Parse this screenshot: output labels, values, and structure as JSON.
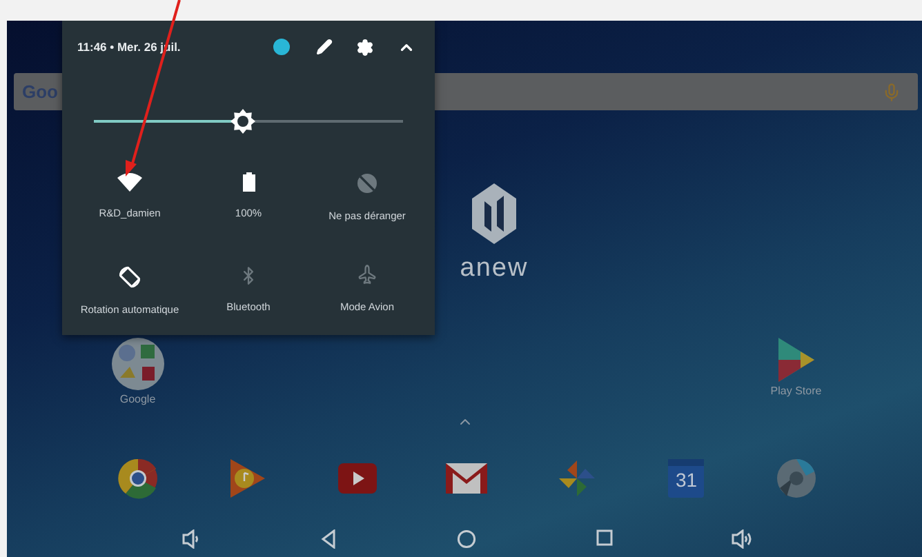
{
  "quick_settings": {
    "time_date": "11:46 • Mer. 26 juil.",
    "brightness": {
      "level": 0.48
    },
    "tiles": [
      {
        "kind": "wifi",
        "label": "R&D_damien",
        "on": true
      },
      {
        "kind": "battery",
        "label": "100%",
        "on": true
      },
      {
        "kind": "dnd",
        "label": "Ne pas déranger",
        "on": false
      },
      {
        "kind": "rotation",
        "label": "Rotation automatique",
        "on": true
      },
      {
        "kind": "bluetooth",
        "label": "Bluetooth",
        "on": false
      },
      {
        "kind": "airplane",
        "label": "Mode Avion",
        "on": false
      }
    ]
  },
  "search_bar": {
    "text": "Goo"
  },
  "logo": {
    "text": "anew"
  },
  "home_apps": [
    {
      "kind": "folder",
      "label": "Google"
    },
    {
      "kind": "playstore",
      "label": "Play Store"
    }
  ],
  "dock": [
    {
      "kind": "chrome"
    },
    {
      "kind": "music"
    },
    {
      "kind": "youtube"
    },
    {
      "kind": "gmail"
    },
    {
      "kind": "photos"
    },
    {
      "kind": "calendar",
      "text": "31"
    },
    {
      "kind": "camera"
    }
  ],
  "nav_bar": [
    {
      "kind": "volume_down"
    },
    {
      "kind": "back"
    },
    {
      "kind": "home"
    },
    {
      "kind": "recents"
    },
    {
      "kind": "volume_up"
    }
  ]
}
